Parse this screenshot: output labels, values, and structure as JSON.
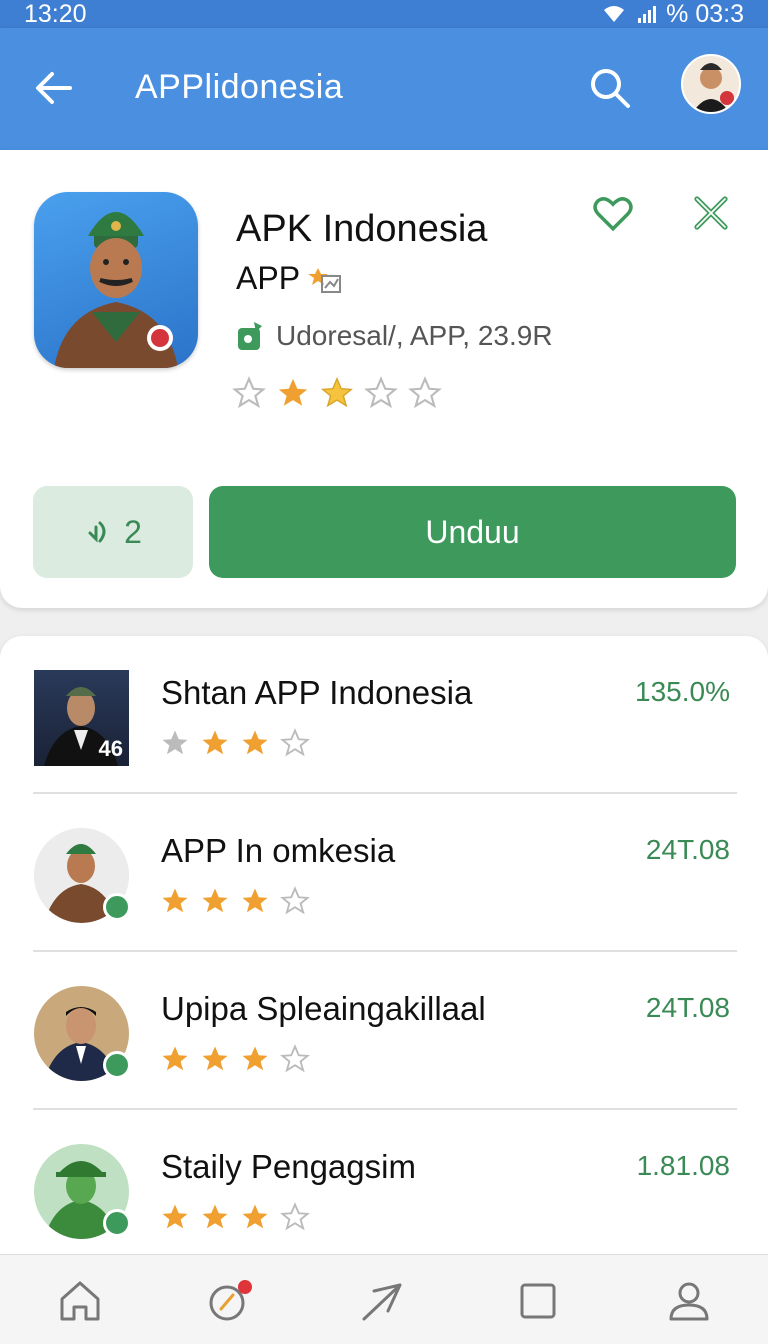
{
  "status_bar": {
    "time": "13:20",
    "right_text": "% 03:3"
  },
  "app_bar": {
    "title": "APPlidonesia"
  },
  "app": {
    "name": "APK Indonesia",
    "sub": "APP",
    "meta": "Udoresal/, APP, 23.9R",
    "rating": 2.5,
    "count_label": "2",
    "download_label": "Unduu"
  },
  "list": [
    {
      "name": "Shtan APP Indonesia",
      "value": "135.0%",
      "rating": 3,
      "thumb_text": "46"
    },
    {
      "name": "APP In omkesia",
      "value": "24T.08",
      "rating": 3
    },
    {
      "name": "Upipa Spleaingakillaal",
      "value": "24T.08",
      "rating": 3
    },
    {
      "name": "Staily Pengagsim",
      "value": "1.81.08",
      "rating": 3
    }
  ],
  "colors": {
    "app_bar": "#4a8fe0",
    "accent_green": "#3e9a5c",
    "star": "#f0a030"
  },
  "icons": [
    "back-arrow-icon",
    "search-icon",
    "heart-icon",
    "close-icon",
    "home-icon",
    "explore-icon",
    "send-icon",
    "square-icon",
    "profile-icon"
  ]
}
